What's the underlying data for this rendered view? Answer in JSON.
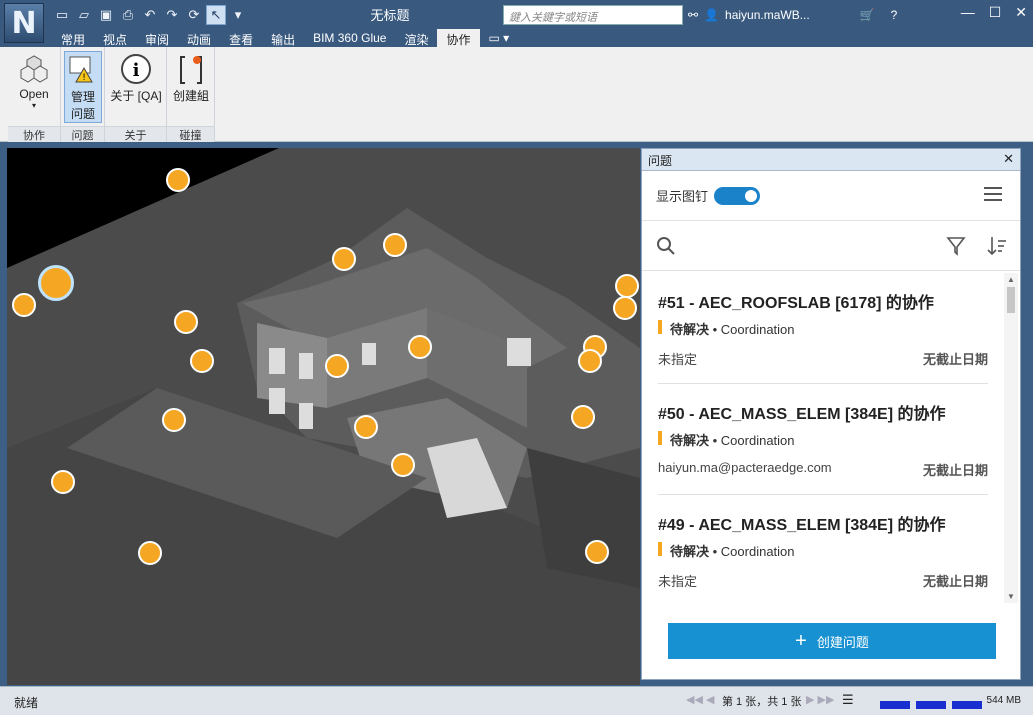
{
  "app": {
    "title": "无标题",
    "logo_letter": "N",
    "search_placeholder": "鍵入关鍵字或短语",
    "user": "haiyun.maWB..."
  },
  "tabs": [
    "常用",
    "视点",
    "审阅",
    "动画",
    "查看",
    "输出",
    "BIM 360 Glue",
    "渲染",
    "协作"
  ],
  "active_tab": "协作",
  "ribbon": {
    "groups": [
      {
        "label": "协作",
        "buttons": [
          {
            "label": "Open",
            "icon": "cubes-icon"
          }
        ]
      },
      {
        "label": "问题",
        "buttons": [
          {
            "label_line1": "管理",
            "label_line2": "问题",
            "icon": "issue-warning-icon"
          }
        ]
      },
      {
        "label": "关于",
        "buttons": [
          {
            "label": "关于 [QA]",
            "icon": "info-icon"
          }
        ]
      },
      {
        "label": "碰撞",
        "buttons": [
          {
            "label": "创建組",
            "icon": "bracket-star-icon"
          }
        ]
      }
    ]
  },
  "panel": {
    "title": "问题",
    "show_pins_label": "显示图钉",
    "show_pins": true,
    "issues": [
      {
        "title": "#51 - AEC_ROOFSLAB [6178] 的协作",
        "status": "待解决",
        "type": "Coordination",
        "assignee": "未指定",
        "due": "无截止日期"
      },
      {
        "title": "#50 - AEC_MASS_ELEM [384E] 的协作",
        "status": "待解决",
        "type": "Coordination",
        "assignee": "haiyun.ma@pacteraedge.com",
        "due": "无截止日期"
      },
      {
        "title": "#49 - AEC_MASS_ELEM [384E] 的协作",
        "status": "待解决",
        "type": "Coordination",
        "assignee": "未指定",
        "due": "无截止日期"
      }
    ],
    "create_label": "创建问题"
  },
  "statusbar": {
    "ready": "就绪",
    "page": "第 1 张，共 1 张",
    "memory": "544 MB"
  },
  "colors": {
    "pin": "#f5a623",
    "accent": "#1791d1",
    "status_open": "#f5a623"
  }
}
